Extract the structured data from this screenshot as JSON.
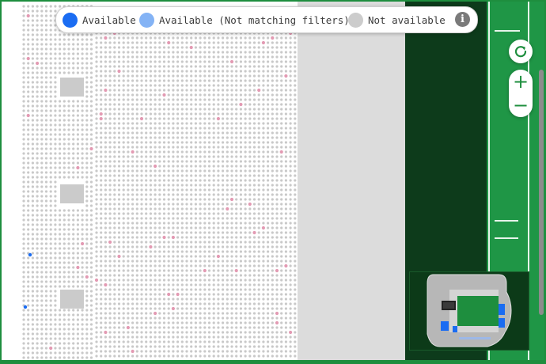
{
  "legend": {
    "items": [
      {
        "key": "available",
        "label": "Available",
        "color": "#1a6cf2"
      },
      {
        "key": "available-filtered",
        "label": "Available (Not matching filters)",
        "color": "#84b3f5"
      },
      {
        "key": "not-available",
        "label": "Not available",
        "color": "#cccccc"
      }
    ],
    "info_glyph": "i"
  },
  "controls": {
    "reset_icon": "reset-icon",
    "zoom_in_label": "+",
    "zoom_out_label": "−"
  },
  "colors": {
    "seat_unavailable": "#c9c9c9",
    "seat_selected_pink": "#e39ab3",
    "seat_available": "#1a6cf2",
    "field_dark": "#0d3b1b",
    "field_grass": "#1f9646",
    "brand_green": "#1e8e3e"
  }
}
